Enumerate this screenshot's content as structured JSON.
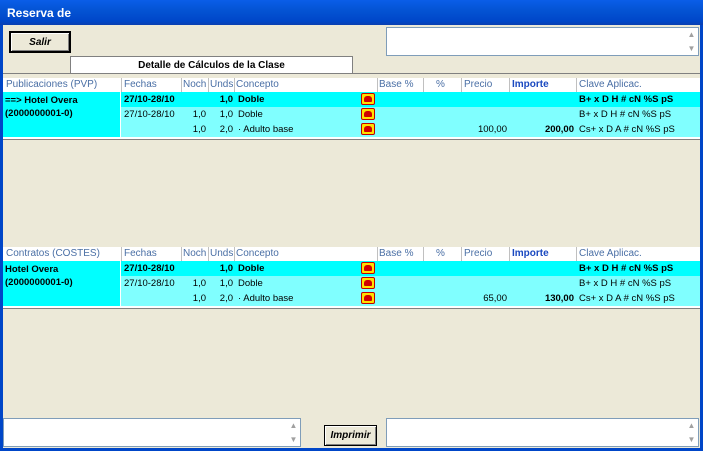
{
  "window": {
    "title": "Reserva de"
  },
  "toolbar": {
    "exit_label": "Salir",
    "print_label": "Imprimir"
  },
  "tab": {
    "label": "Detalle de Cálculos de la Clase"
  },
  "columns": [
    "Fechas",
    "Noch",
    "Unds",
    "Concepto",
    "Base %",
    "%",
    "Precio",
    "Importe",
    "Clave Aplicac."
  ],
  "publicaciones": {
    "section_label": "Publicaciones (PVP)",
    "hotel_line1": "==> Hotel Overa",
    "hotel_line2": "(2000000001-0)",
    "rows": [
      {
        "fechas": "27/10-28/10",
        "noch": "",
        "unds": "1,0",
        "concepto": "Doble",
        "precio": "",
        "importe": "",
        "clave": "B+ x D H #  cN  %S pS"
      },
      {
        "fechas": "27/10-28/10",
        "noch": "1,0",
        "unds": "1,0",
        "concepto": "Doble",
        "precio": "",
        "importe": "",
        "clave": "B+ x D H #  cN  %S pS"
      },
      {
        "fechas": "",
        "noch": "1,0",
        "unds": "2,0",
        "concepto": "·  Adulto base",
        "precio": "100,00",
        "importe": "200,00",
        "clave": "Cs+ x D A #  cN  %S pS"
      }
    ]
  },
  "contratos": {
    "section_label": "Contratos (COSTES)",
    "hotel_line1": "Hotel Overa",
    "hotel_line2": "(2000000001-0)",
    "rows": [
      {
        "fechas": "27/10-28/10",
        "noch": "",
        "unds": "1,0",
        "concepto": "Doble",
        "precio": "",
        "importe": "",
        "clave": "B+ x D H #  cN  %S pS"
      },
      {
        "fechas": "27/10-28/10",
        "noch": "1,0",
        "unds": "1,0",
        "concepto": "Doble",
        "precio": "",
        "importe": "",
        "clave": "B+ x D H #  cN  %S pS"
      },
      {
        "fechas": "",
        "noch": "1,0",
        "unds": "2,0",
        "concepto": "·  Adulto base",
        "precio": "65,00",
        "importe": "130,00",
        "clave": "Cs+ x D A #  cN  %S pS"
      }
    ]
  },
  "colors": {
    "title_bar": "#0454d4",
    "row_highlight": "#00ffff",
    "row_light": "#80ffff",
    "header_text": "#4a6fa5",
    "importe_header": "#1a49c0"
  }
}
